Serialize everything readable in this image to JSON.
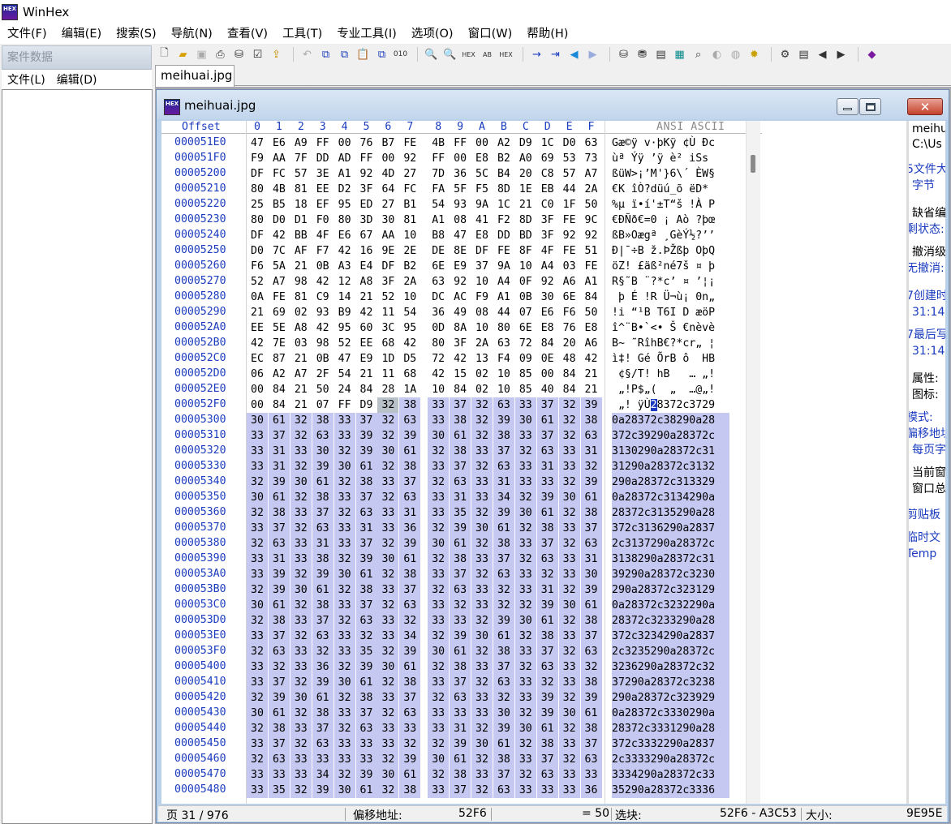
{
  "app": {
    "title": "WinHex",
    "logo_text": "HEX"
  },
  "menubar": [
    "文件(F)",
    "编辑(E)",
    "搜索(S)",
    "导航(N)",
    "查看(V)",
    "工具(T)",
    "专业工具(I)",
    "选项(O)",
    "窗口(W)",
    "帮助(H)"
  ],
  "case_pane": {
    "title": "案件数据",
    "menu": [
      "文件(L)",
      "编辑(D)"
    ]
  },
  "tab": {
    "label": "meihuai.jpg"
  },
  "child_window": {
    "title": "meihuai.jpg",
    "close_label": "✕"
  },
  "hex": {
    "offset_header": "Offset",
    "columns": [
      "0",
      "1",
      "2",
      "3",
      "4",
      "5",
      "6",
      "7",
      "8",
      "9",
      "A",
      "B",
      "C",
      "D",
      "E",
      "F"
    ],
    "ascii_header": "ANSI ASCII",
    "rows": [
      {
        "offset": "000051E0",
        "bytes": "47 E6 A9 FF 00 76 B7 FE 4B FF 00 A2 D9 1C D0 63",
        "ascii": "Gæ©ÿ v·þKÿ ¢Ù Ðc"
      },
      {
        "offset": "000051F0",
        "bytes": "F9 AA 7F DD AD FF 00 92 FF 00 E8 B2 A0 69 53 73",
        "ascii": "ùª Ý­ÿ ’ÿ è² iSs"
      },
      {
        "offset": "00005200",
        "bytes": "DF FC 57 3E A1 92 4D 27 7D 36 5C B4 20 C8 57 A7",
        "ascii": "ßüW>¡’M'}6\\´ ÈW§"
      },
      {
        "offset": "00005210",
        "bytes": "80 4B 81 EE D2 3F 64 FC FA 5F F5 8D 1E EB 44 2A",
        "ascii": "€K îÒ?düú_õ ëD*"
      },
      {
        "offset": "00005220",
        "bytes": "25 B5 18 EF 95 ED 27 B1 54 93 9A 1C 21 C0 1F 50",
        "ascii": "%µ ï•í'±T“š !À P"
      },
      {
        "offset": "00005230",
        "bytes": "80 D0 D1 F0 80 3D 30 81 A1 08 41 F2 8D 3F FE 9C",
        "ascii": "€ÐÑð€=0 ¡ Aò ?þœ"
      },
      {
        "offset": "00005240",
        "bytes": "DF 42 BB 4F E6 67 AA 10 B8 47 E8 DD BD 3F 92 92",
        "ascii": "ßB»Oægª ¸GèÝ½?’’"
      },
      {
        "offset": "00005250",
        "bytes": "D0 7C AF F7 42 16 9E 2E DE 8E DF FE 8F 4F FE 51",
        "ascii": "Ð|¯÷B ž.ÞŽßþ OþQ"
      },
      {
        "offset": "00005260",
        "bytes": "F6 5A 21 0B A3 E4 DF B2 6E E9 37 9A 10 A4 03 FE",
        "ascii": "öZ! £äß²né7š ¤ þ"
      },
      {
        "offset": "00005270",
        "bytes": "52 A7 98 42 12 A8 3F 2A 63 92 10 A4 0F 92 A6 A1",
        "ascii": "R§˜B ¨?*c’ ¤ ’¦¡"
      },
      {
        "offset": "00005280",
        "bytes": "0A FE 81 C9 14 21 52 10 DC AC F9 A1 0B 30 6E 84",
        "ascii": " þ É !R Ü¬ù¡ 0n„"
      },
      {
        "offset": "00005290",
        "bytes": "21 69 02 93 B9 42 11 54 36 49 08 44 07 E6 F6 50",
        "ascii": "!i “¹B T6I D æöP"
      },
      {
        "offset": "000052A0",
        "bytes": "EE 5E A8 42 95 60 3C 95 0D 8A 10 80 6E E8 76 E8",
        "ascii": "î^¨B•`<• Š €nèvè"
      },
      {
        "offset": "000052B0",
        "bytes": "42 7E 03 98 52 EE 68 42 80 3F 2A 63 72 84 20 A6",
        "ascii": "B~ ˜RîhB€?*cr„ ¦"
      },
      {
        "offset": "000052C0",
        "bytes": "EC 87 21 0B 47 E9 1D D5 72 42 13 F4 09 0E 48 42",
        "ascii": "ì‡! Gé ÕrB ô  HB"
      },
      {
        "offset": "000052D0",
        "bytes": "06 A2 A7 2F 54 21 11 68 42 15 02 10 85 00 84 21",
        "ascii": " ¢§/T! hB   … „!"
      },
      {
        "offset": "000052E0",
        "bytes": "00 84 21 50 24 84 28 1A 10 84 02 10 85 40 84 21",
        "ascii": " „!P$„(  „  …@„!"
      },
      {
        "offset": "000052F0",
        "bytes": "00 84 21 07 FF D9 32 38 33 37 32 63 33 37 32 39",
        "ascii": " „! ÿÙ28372c3729"
      },
      {
        "offset": "00005300",
        "bytes": "30 61 32 38 33 37 32 63 33 38 32 39 30 61 32 38",
        "ascii": "0a28372c38290a28"
      },
      {
        "offset": "00005310",
        "bytes": "33 37 32 63 33 39 32 39 30 61 32 38 33 37 32 63",
        "ascii": "372c39290a28372c"
      },
      {
        "offset": "00005320",
        "bytes": "33 31 33 30 32 39 30 61 32 38 33 37 32 63 33 31",
        "ascii": "3130290a28372c31"
      },
      {
        "offset": "00005330",
        "bytes": "33 31 32 39 30 61 32 38 33 37 32 63 33 31 33 32",
        "ascii": "31290a28372c3132"
      },
      {
        "offset": "00005340",
        "bytes": "32 39 30 61 32 38 33 37 32 63 33 31 33 33 32 39",
        "ascii": "290a28372c313329"
      },
      {
        "offset": "00005350",
        "bytes": "30 61 32 38 33 37 32 63 33 31 33 34 32 39 30 61",
        "ascii": "0a28372c3134290a"
      },
      {
        "offset": "00005360",
        "bytes": "32 38 33 37 32 63 33 31 33 35 32 39 30 61 32 38",
        "ascii": "28372c3135290a28"
      },
      {
        "offset": "00005370",
        "bytes": "33 37 32 63 33 31 33 36 32 39 30 61 32 38 33 37",
        "ascii": "372c3136290a2837"
      },
      {
        "offset": "00005380",
        "bytes": "32 63 33 31 33 37 32 39 30 61 32 38 33 37 32 63",
        "ascii": "2c3137290a28372c"
      },
      {
        "offset": "00005390",
        "bytes": "33 31 33 38 32 39 30 61 32 38 33 37 32 63 33 31",
        "ascii": "3138290a28372c31"
      },
      {
        "offset": "000053A0",
        "bytes": "33 39 32 39 30 61 32 38 33 37 32 63 33 32 33 30",
        "ascii": "39290a28372c3230"
      },
      {
        "offset": "000053B0",
        "bytes": "32 39 30 61 32 38 33 37 32 63 33 32 33 31 32 39",
        "ascii": "290a28372c323129"
      },
      {
        "offset": "000053C0",
        "bytes": "30 61 32 38 33 37 32 63 33 32 33 32 32 39 30 61",
        "ascii": "0a28372c3232290a"
      },
      {
        "offset": "000053D0",
        "bytes": "32 38 33 37 32 63 33 32 33 33 32 39 30 61 32 38",
        "ascii": "28372c3233290a28"
      },
      {
        "offset": "000053E0",
        "bytes": "33 37 32 63 33 32 33 34 32 39 30 61 32 38 33 37",
        "ascii": "372c3234290a2837"
      },
      {
        "offset": "000053F0",
        "bytes": "32 63 33 32 33 35 32 39 30 61 32 38 33 37 32 63",
        "ascii": "2c3235290a28372c"
      },
      {
        "offset": "00005400",
        "bytes": "33 32 33 36 32 39 30 61 32 38 33 37 32 63 33 32",
        "ascii": "3236290a28372c32"
      },
      {
        "offset": "00005410",
        "bytes": "33 37 32 39 30 61 32 38 33 37 32 63 33 32 33 38",
        "ascii": "37290a28372c3238"
      },
      {
        "offset": "00005420",
        "bytes": "32 39 30 61 32 38 33 37 32 63 33 32 33 39 32 39",
        "ascii": "290a28372c323929"
      },
      {
        "offset": "00005430",
        "bytes": "30 61 32 38 33 37 32 63 33 33 33 30 32 39 30 61",
        "ascii": "0a28372c3330290a"
      },
      {
        "offset": "00005440",
        "bytes": "32 38 33 37 32 63 33 33 33 31 32 39 30 61 32 38",
        "ascii": "28372c3331290a28"
      },
      {
        "offset": "00005450",
        "bytes": "33 37 32 63 33 33 33 32 32 39 30 61 32 38 33 37",
        "ascii": "372c3332290a2837"
      },
      {
        "offset": "00005460",
        "bytes": "32 63 33 33 33 33 32 39 30 61 32 38 33 37 32 63",
        "ascii": "2c3333290a28372c"
      },
      {
        "offset": "00005470",
        "bytes": "33 33 33 34 32 39 30 61 32 38 33 37 32 63 33 33",
        "ascii": "3334290a28372c33"
      },
      {
        "offset": "00005480",
        "bytes": "33 35 32 39 30 61 32 38 33 37 32 63 33 33 33 36",
        "ascii": "35290a28372c3336"
      }
    ]
  },
  "info_panel": {
    "items": [
      "meihu",
      "C:\\Us",
      "5文件大",
      "字节",
      "缺省编",
      "剩状态:",
      "撤消级",
      "无撤消:",
      "7创建时",
      "31:14",
      "7最后写",
      "31:14",
      "属性:",
      "图标:",
      "模式:",
      "偏移地址:",
      "每页字",
      "当前窗",
      "窗口总",
      "剪贴板",
      "临时文",
      "Temp"
    ]
  },
  "statusbar": {
    "page": "页 31 / 976",
    "offset_label": "偏移地址:",
    "offset_value": "52F6",
    "byte_value": "= 50",
    "block_label": "选块:",
    "block_value": "52F6 - A3C53",
    "size_label": "大小:",
    "size_value": "9E95E"
  },
  "colors": {
    "selection": "#c5c8f0",
    "offset_blue": "#1a3bbf",
    "cursor": "#1a3bbf"
  }
}
